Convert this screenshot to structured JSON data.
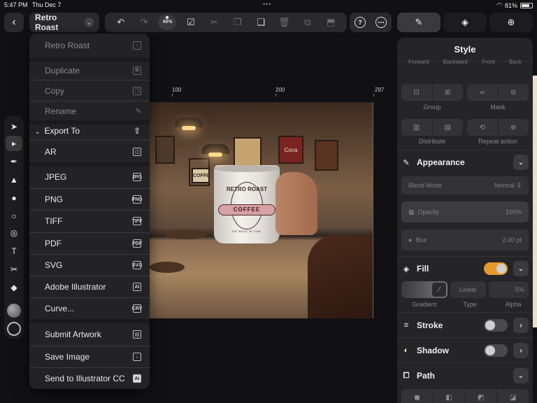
{
  "status": {
    "time": "5:47 PM",
    "date": "Thu Dec 7",
    "battery": "81%",
    "battery_level": 0.81,
    "wifi_icon": "wifi-icon"
  },
  "toolbar": {
    "doc_title": "Retro Roast",
    "zoom": "40%",
    "icons": [
      "back-icon",
      "undo-icon",
      "redo-icon",
      "zoom-chip",
      "select-check-icon",
      "scissors-icon",
      "copy-icon",
      "paste-icon",
      "trash-icon",
      "duplicate-icon",
      "help-icon",
      "more-icon"
    ]
  },
  "panel_tabs": [
    {
      "name": "style-tab",
      "icon": "brush-icon",
      "active": true
    },
    {
      "name": "layers-tab",
      "icon": "layers-icon",
      "active": false
    },
    {
      "name": "add-tab",
      "icon": "plus-icon",
      "active": false
    }
  ],
  "ruler": {
    "ticks": [
      "100",
      "200",
      "297"
    ]
  },
  "artwork": {
    "mug_brand": "RETRO ROAST",
    "mug_badge": "COFFEE",
    "mug_tagline": "SIP BACK IN TIME",
    "signs": [
      "Coca Cola",
      "COFFEE",
      "COFFE"
    ]
  },
  "menu": {
    "items_top": [
      {
        "label": "Retro Roast",
        "icon": "share-icon",
        "dim": true
      },
      {
        "label": "Duplicate",
        "icon": "duplicate-icon",
        "dim": true
      },
      {
        "label": "Copy",
        "icon": "copy-icon",
        "dim": true
      },
      {
        "label": "Rename",
        "icon": "pencil-icon",
        "dim": true
      }
    ],
    "export_header": "Export To",
    "formats": [
      {
        "label": "AR",
        "tag": "AR"
      },
      {
        "label": "JPEG",
        "tag": "JPG"
      },
      {
        "label": "PNG",
        "tag": "PNG"
      },
      {
        "label": "TIFF",
        "tag": "TIFF"
      },
      {
        "label": "PDF",
        "tag": "PDF"
      },
      {
        "label": "SVG",
        "tag": "SVG"
      },
      {
        "label": "Adobe Illustrator",
        "tag": "AI"
      },
      {
        "label": "Curve...",
        "tag": "CRV"
      }
    ],
    "items_bottom": [
      {
        "label": "Submit Artwork",
        "icon": "gallery-icon"
      },
      {
        "label": "Save Image",
        "icon": "save-icon"
      },
      {
        "label": "Send to Illustrator CC",
        "icon": "ai-badge-icon",
        "tag": "Ai"
      }
    ]
  },
  "style_panel": {
    "title": "Style",
    "arrange_labels": [
      "Forward",
      "Backward",
      "Front",
      "Back"
    ],
    "group_label": "Group",
    "mask_label": "Mask",
    "distribute_label": "Distribute",
    "repeat_label": "Repeat action",
    "appearance": {
      "title": "Appearance",
      "blend_mode_label": "Blend Mode",
      "blend_mode_value": "Normal",
      "opacity_label": "Opacity",
      "opacity_value": "100%",
      "blur_label": "Blur",
      "blur_value": "2.00 pt"
    },
    "fill": {
      "title": "Fill",
      "enabled": true,
      "type_value": "Linear",
      "alpha_value": "5%",
      "gradient_label": "Gradient",
      "type_label": "Type",
      "alpha_label": "Alpha"
    },
    "stroke": {
      "title": "Stroke",
      "enabled": false
    },
    "shadow": {
      "title": "Shadow",
      "enabled": false
    },
    "path": {
      "title": "Path"
    },
    "colors": {
      "toggle_on": "#e69a2e"
    }
  }
}
